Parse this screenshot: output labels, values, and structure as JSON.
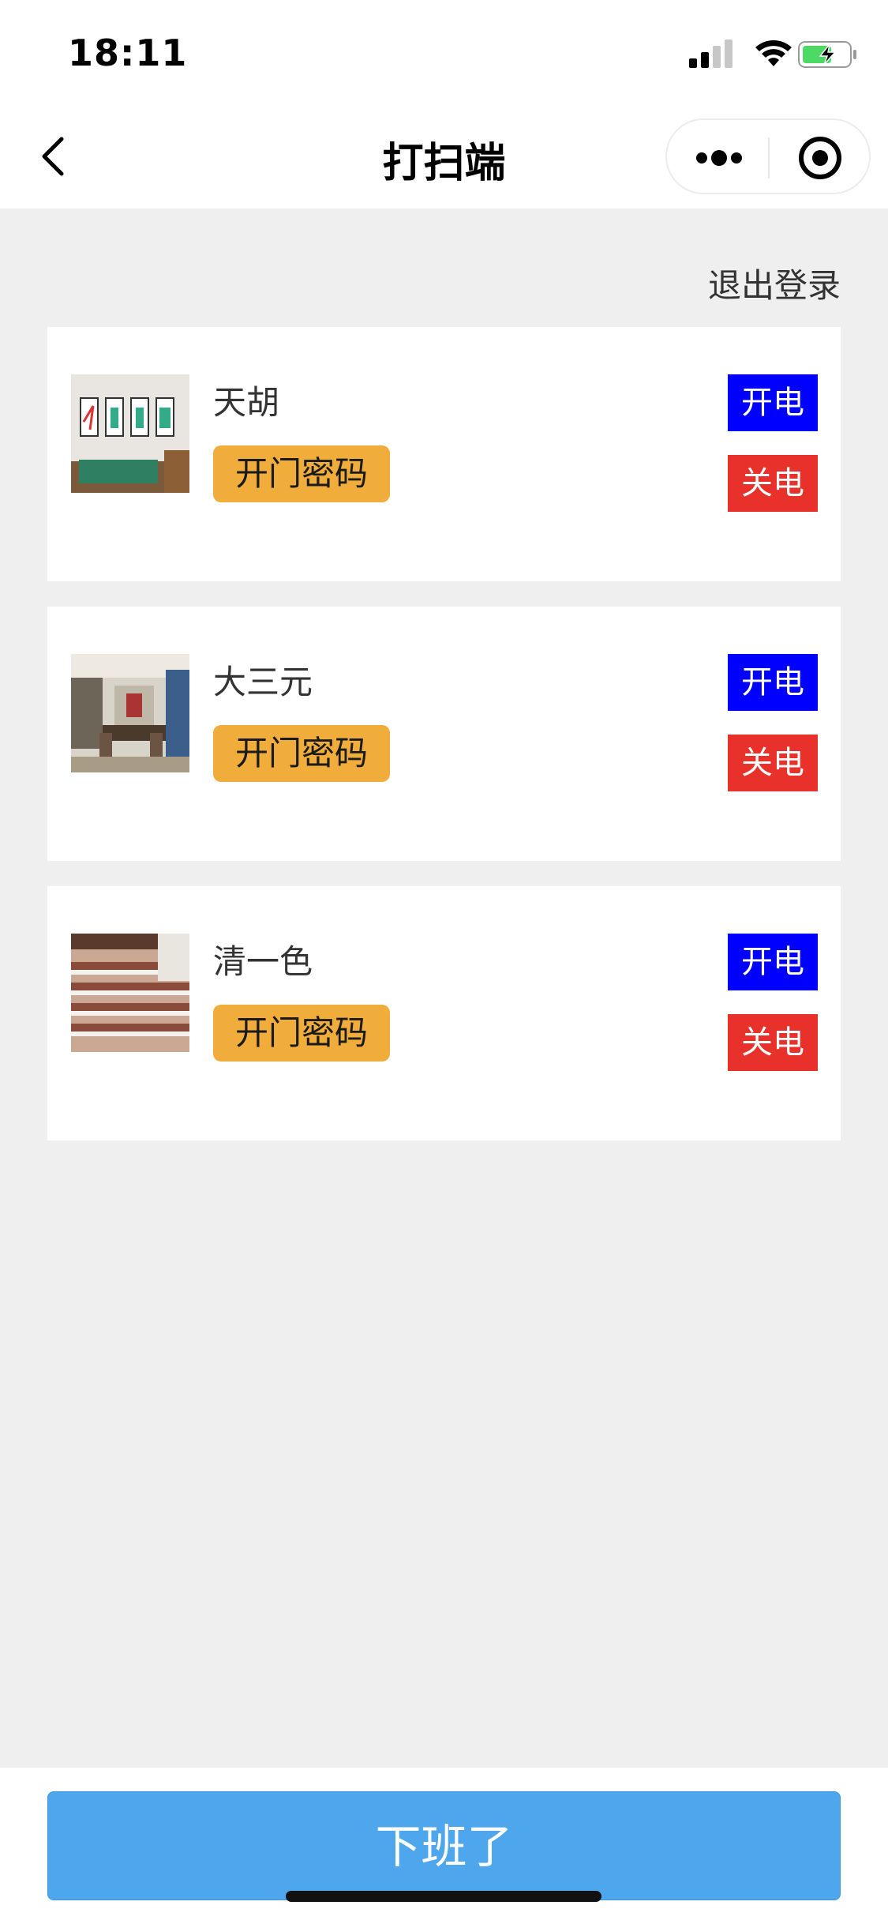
{
  "status_bar": {
    "time": "18:11",
    "icons": [
      "cellular-signal-icon",
      "wifi-icon",
      "battery-charging-icon"
    ]
  },
  "nav": {
    "title": "打扫端",
    "back_icon": "chevron-left-icon",
    "more_icon": "more-dots-icon",
    "close_icon": "target-circle-icon"
  },
  "logout_label": "退出登录",
  "rooms": [
    {
      "name": "天胡",
      "password_label": "开门密码",
      "power_on_label": "开电",
      "power_off_label": "关电",
      "thumbnail": "mahjong-room-photo"
    },
    {
      "name": "大三元",
      "password_label": "开门密码",
      "power_on_label": "开电",
      "power_off_label": "关电",
      "thumbnail": "dining-room-photo"
    },
    {
      "name": "清一色",
      "password_label": "开门密码",
      "power_on_label": "开电",
      "power_off_label": "关电",
      "thumbnail": "building-photo"
    }
  ],
  "bottom": {
    "off_work_label": "下班了"
  },
  "colors": {
    "power_on": "#0000ff",
    "power_off": "#e8312b",
    "password_button": "#f0ad3b",
    "primary_button": "#4ea7ec",
    "background": "#efefef"
  }
}
